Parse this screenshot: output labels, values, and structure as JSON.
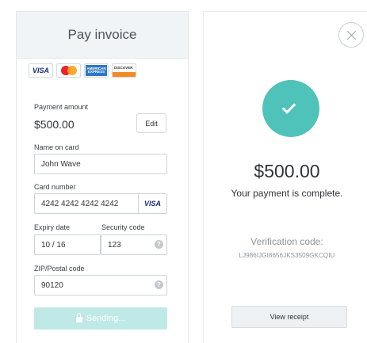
{
  "pay_form": {
    "title": "Pay invoice",
    "card_logos": [
      {
        "name": "visa",
        "label": "VISA"
      },
      {
        "name": "mastercard"
      },
      {
        "name": "amex",
        "label": "AMERICAN EXPRESS"
      },
      {
        "name": "discover",
        "label": "DISCOVER"
      }
    ],
    "payment_amount_label": "Payment amount",
    "payment_amount_value": "$500.00",
    "edit_label": "Edit",
    "name_label": "Name on card",
    "name_value": "John Wave",
    "card_number_label": "Card number",
    "card_number_value": "4242 4242 4242 4242",
    "card_brand": "VISA",
    "expiry_label": "Expiry date",
    "expiry_value": "10 / 16",
    "security_label": "Security code",
    "security_value": "123",
    "zip_label": "ZIP/Postal code",
    "zip_value": "90120",
    "help_icon": "?",
    "submit_label": "Sending..."
  },
  "confirmation": {
    "amount": "$500.00",
    "message": "Your payment is complete.",
    "verification_label": "Verification code:",
    "verification_code": "LJ986IJGI8656JKS3509GKCQIU",
    "receipt_label": "View receipt"
  },
  "colors": {
    "accent": "#4fc3b9",
    "button_disabled": "#bfe9e6",
    "header_bg": "#f1f4f6"
  }
}
